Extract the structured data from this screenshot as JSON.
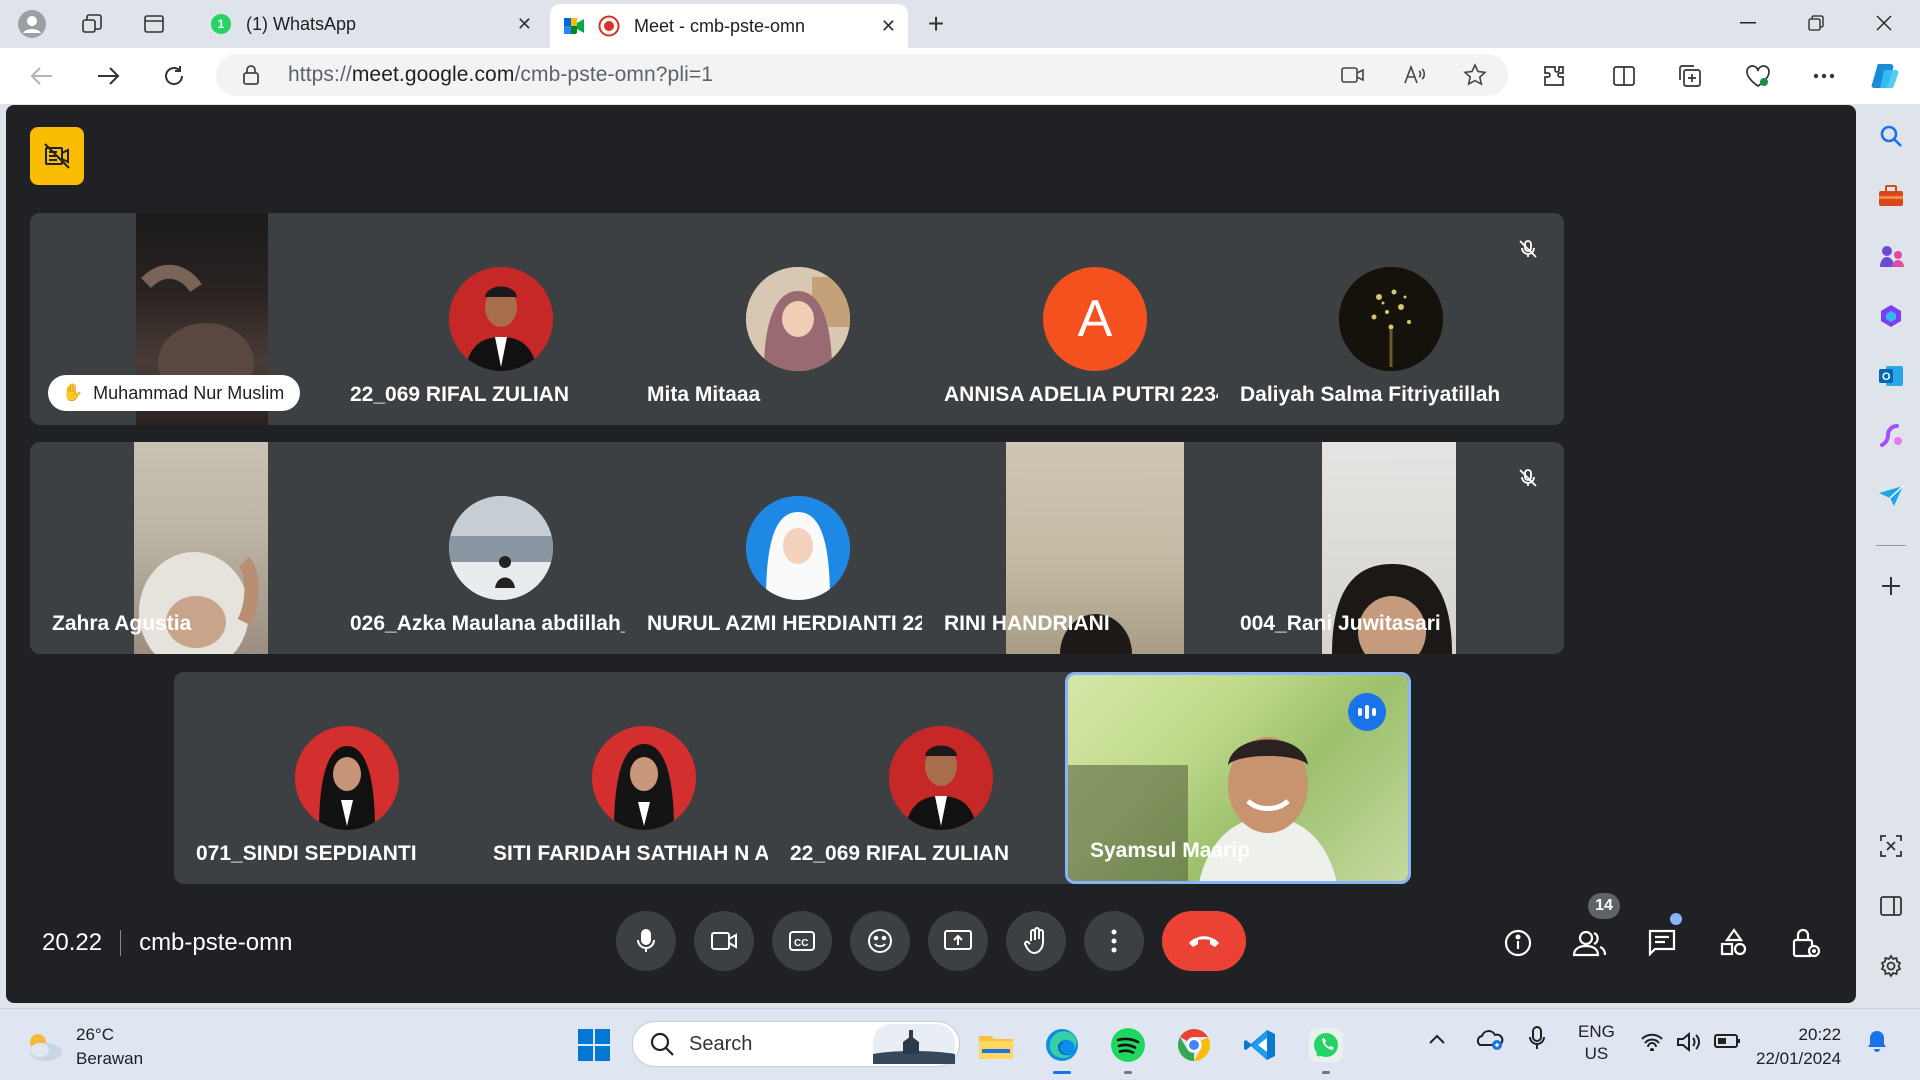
{
  "browser": {
    "tabs": [
      {
        "title": "(1) WhatsApp",
        "badge": "1"
      },
      {
        "title": "Meet - cmb-pste-omn"
      }
    ],
    "url": {
      "scheme": "https://",
      "host": "meet.google.com",
      "path": "/cmb-pste-omn?pli=1"
    }
  },
  "meet": {
    "time": "20.22",
    "code": "cmb-pste-omn",
    "participant_count": "14",
    "tiles": [
      {
        "name": "Muhammad Nur Muslim",
        "type": "video",
        "hand_raised": true,
        "muted": true
      },
      {
        "name": "22_069 RIFAL ZULIAN",
        "type": "photo",
        "muted": true
      },
      {
        "name": "Mita Mitaaa",
        "type": "photo",
        "muted": true
      },
      {
        "name": "ANNISA ADELIA PUTRI 2234...",
        "type": "initial",
        "initial": "A",
        "color": "#f4511e",
        "muted": true
      },
      {
        "name": "Daliyah Salma Fitriyatillah",
        "type": "photo",
        "muted": true
      },
      {
        "name": "Zahra Agustia",
        "type": "video",
        "muted": false
      },
      {
        "name": "026_Azka Maulana abdillah_A",
        "type": "photo",
        "muted": true
      },
      {
        "name": "NURUL AZMI HERDIANTI 222...",
        "type": "photo",
        "muted": true
      },
      {
        "name": "RINI HANDRIANI",
        "type": "video",
        "muted": true
      },
      {
        "name": "004_Rani Juwitasari",
        "type": "video",
        "muted": true
      },
      {
        "name": "071_SINDI SEPDIANTI",
        "type": "photo",
        "muted": true
      },
      {
        "name": "SITI FARIDAH SATHIAH N A ...",
        "type": "photo",
        "muted": true
      },
      {
        "name": "22_069 RIFAL ZULIAN",
        "type": "photo",
        "muted": true
      },
      {
        "name": "Syamsul Maarip",
        "type": "video",
        "speaking": true
      }
    ]
  },
  "taskbar": {
    "weather": {
      "temp": "26°C",
      "desc": "Berawan"
    },
    "search_label": "Search",
    "lang": {
      "line1": "ENG",
      "line2": "US"
    },
    "clock": {
      "time": "20:22",
      "date": "22/01/2024"
    }
  },
  "colors": {
    "meet_bg": "#202124",
    "tile_bg": "#3c4043",
    "end_call": "#ea4335",
    "recording_badge": "#fbbc04",
    "active_border": "#8ab4f8"
  }
}
